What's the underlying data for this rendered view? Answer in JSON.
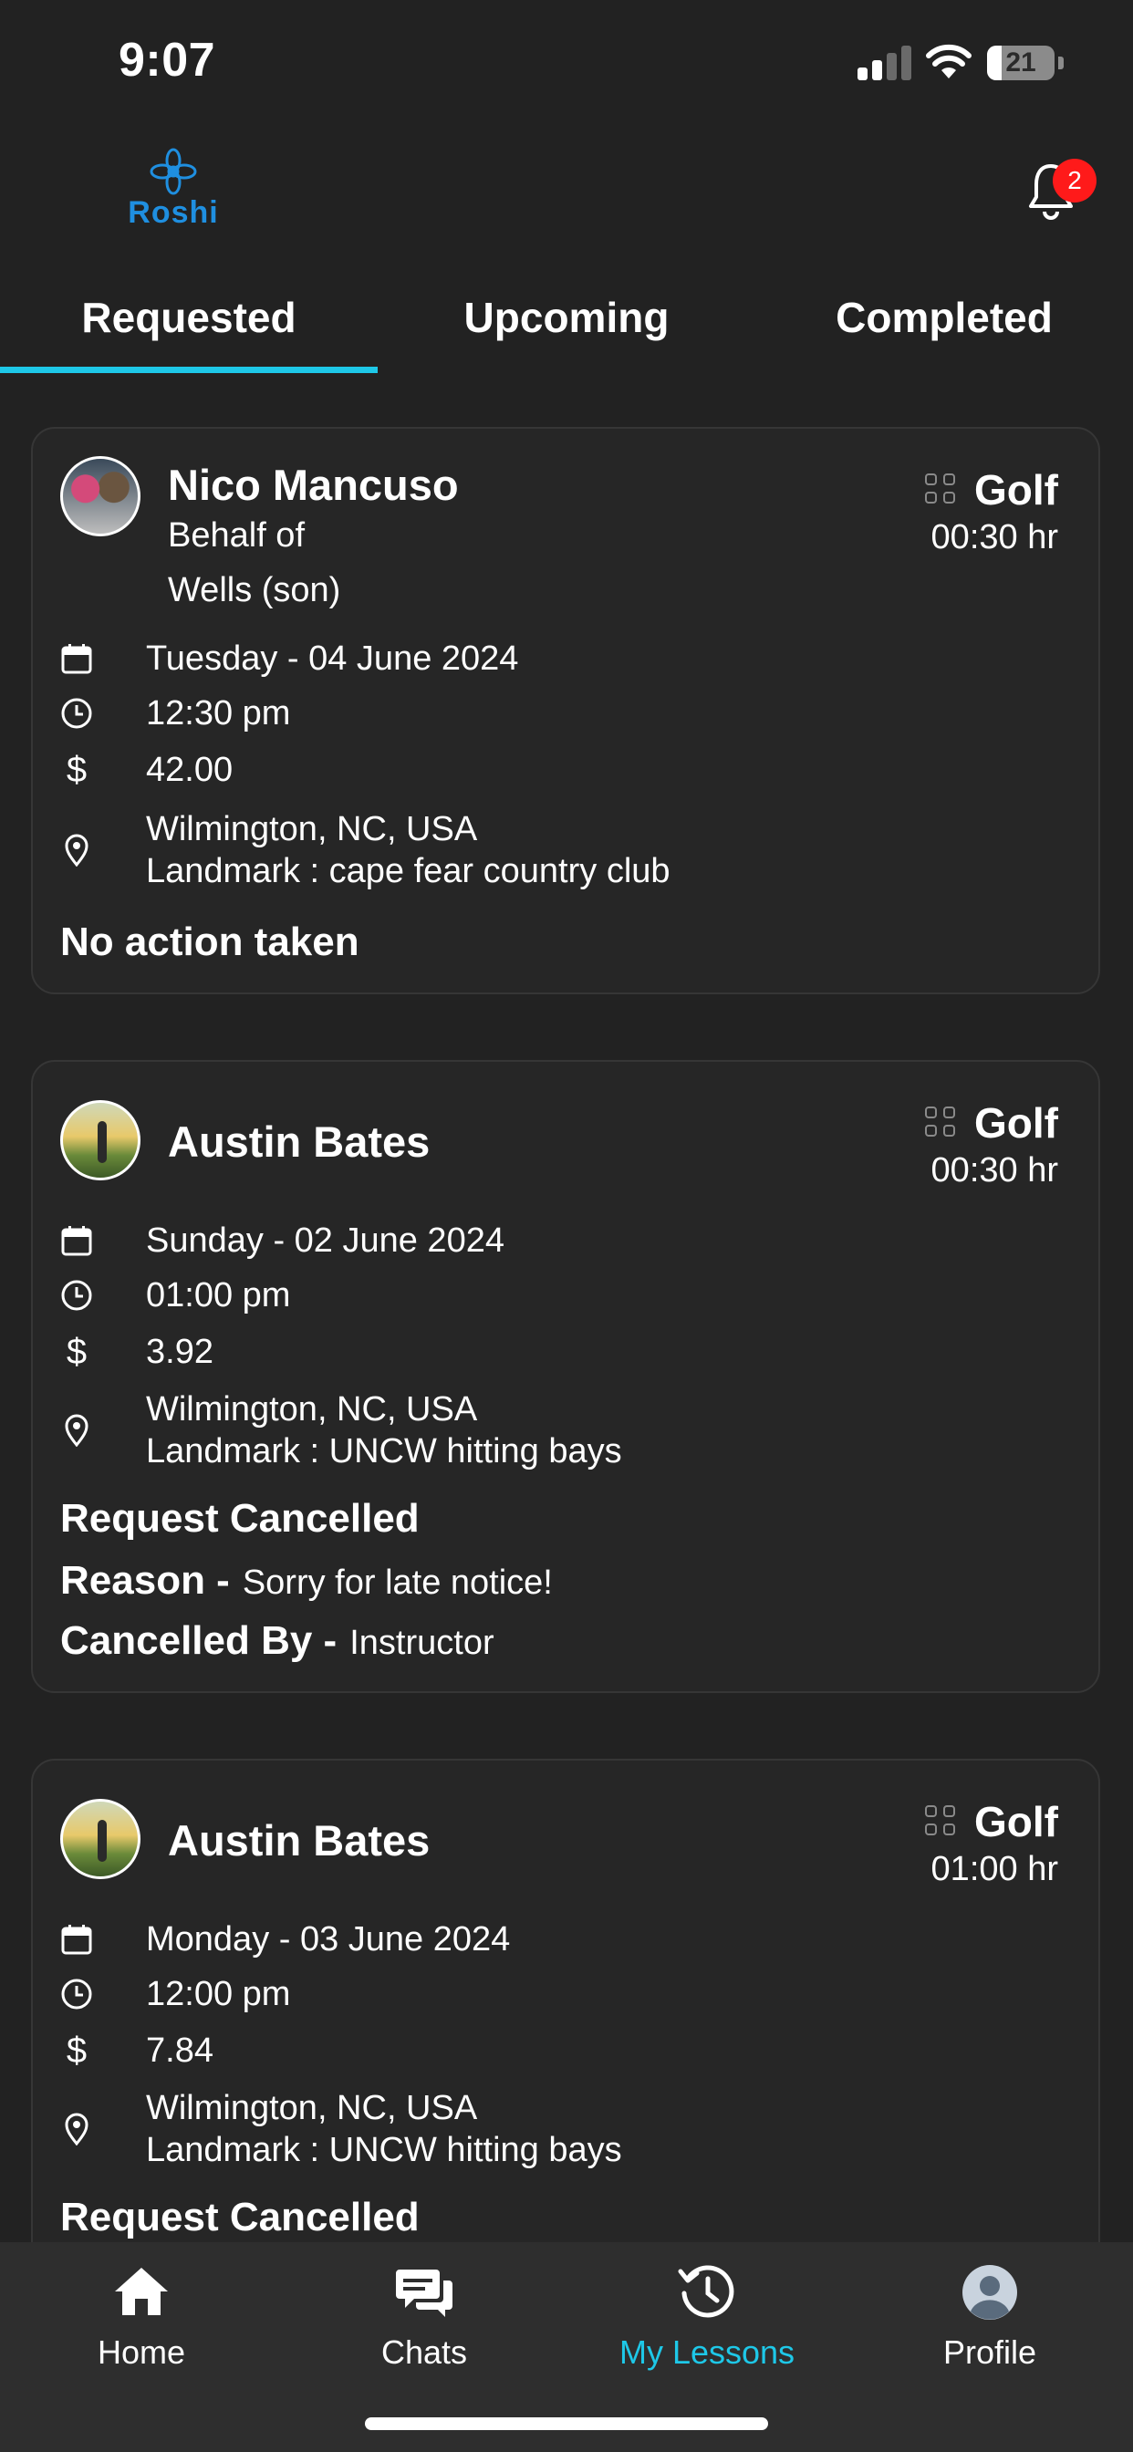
{
  "status_bar": {
    "time": "9:07",
    "battery": "21",
    "battery_level": 0.21
  },
  "app": {
    "logo_text": "Roshi",
    "notification_count": "2"
  },
  "tabs": [
    {
      "label": "Requested",
      "active": true
    },
    {
      "label": "Upcoming",
      "active": false
    },
    {
      "label": "Completed",
      "active": false
    }
  ],
  "lessons": [
    {
      "name": "Nico Mancuso",
      "behalf_line1": "Behalf of",
      "behalf_line2": "Wells (son)",
      "sport": "Golf",
      "duration": "00:30 hr",
      "date": "Tuesday - 04 June 2024",
      "time": "12:30 pm",
      "price": "42.00",
      "location": "Wilmington, NC, USA",
      "landmark": "Landmark : cape fear country club",
      "status": "No action taken"
    },
    {
      "name": "Austin Bates",
      "sport": "Golf",
      "duration": "00:30 hr",
      "date": "Sunday - 02 June 2024",
      "time": "01:00 pm",
      "price": "3.92",
      "location": "Wilmington, NC, USA",
      "landmark": "Landmark : UNCW hitting bays",
      "status": "Request Cancelled",
      "reason_label": "Reason -",
      "reason": "Sorry for late notice!",
      "cancelled_by_label": "Cancelled By -",
      "cancelled_by": "Instructor"
    },
    {
      "name": "Austin Bates",
      "sport": "Golf",
      "duration": "01:00 hr",
      "date": "Monday - 03 June 2024",
      "time": "12:00 pm",
      "price": "7.84",
      "location": "Wilmington, NC, USA",
      "landmark": "Landmark : UNCW hitting bays",
      "status": "Request Cancelled"
    }
  ],
  "bottom_nav": [
    {
      "label": "Home",
      "icon": "home-icon"
    },
    {
      "label": "Chats",
      "icon": "chat-icon"
    },
    {
      "label": "My Lessons",
      "icon": "history-icon",
      "active": true
    },
    {
      "label": "Profile",
      "icon": "profile-icon"
    }
  ],
  "colors": {
    "accent": "#1ec8e8",
    "background": "#222222",
    "card": "#262626",
    "badge": "#ff1a1a",
    "logo": "#1f8fe0"
  }
}
